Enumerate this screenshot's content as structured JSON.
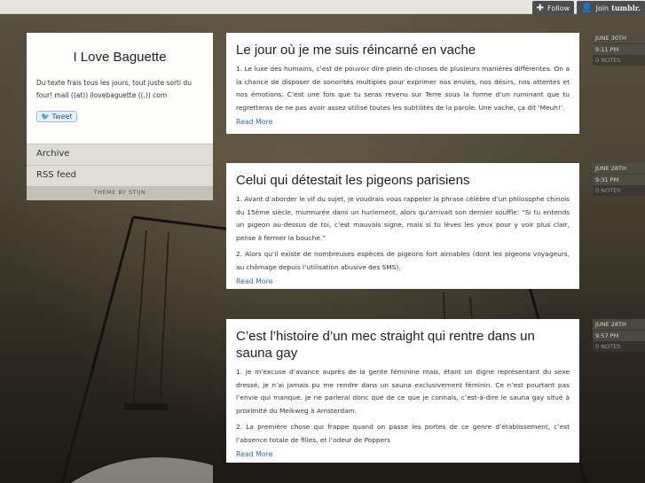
{
  "tumblr": {
    "follow_label": "Follow",
    "join_label": "Join",
    "brand": "tumblr."
  },
  "sidebar": {
    "blog_title": "I Love Baguette",
    "description": "Du texte frais tous les jours, tout juste sorti du four! mail ((at)) ilovebaguette ((.)) com",
    "tweet_label": "Tweet",
    "nav": [
      {
        "label": "Archive"
      },
      {
        "label": "RSS feed"
      }
    ],
    "theme_credit": "THEME BY STIJN"
  },
  "posts": [
    {
      "title": "Le jour où je me suis réincarné en vache",
      "paragraphs": [
        "1. Le luxe des humains, c’est de pouvoir dire plein de choses de plusieurs manières différentes. On a la chance de disposer de sonorités multiples pour exprimer nos envies, nos désirs, nos attentes et nos émotions. C’est une fois que tu seras revenu sur Terre sous la forme d’un ruminant que tu regretteras de ne pas avoir assez utilisé toutes les subtilités de la parole. Une vache, ça dit ‘Meuh!’."
      ],
      "read_more": "Read More",
      "meta": {
        "date": "JUNE 30TH",
        "time": "9:11 PM",
        "notes": "0 NOTES"
      }
    },
    {
      "title": "Celui qui détestait les pigeons parisiens",
      "paragraphs": [
        "1. Avant d’aborder le vif du sujet, je voudrais vous rappeler la phrase célèbre d’un philosophe chinois du 15ème siècle, murmurée dans un hurlement, alors qu’arrivait son dernier souffle: “Si tu entends un pigeon au-dessus de toi, c’est mauvais signe, mais si tu lèves les yeux pour y voir plus clair, pense à fermer la bouche.”",
        "2. Alors qu’il existe de nombreuses espèces de pigeons fort aimables (dont les pigeons voyageurs, au chômage depuis l’utilisation abusive des SMS),"
      ],
      "read_more": "Read More",
      "meta": {
        "date": "JUNE 28TH",
        "time": "9:31 PM",
        "notes": "0 NOTES"
      }
    },
    {
      "title": "C’est l’histoire d’un mec straight qui rentre dans un sauna gay",
      "paragraphs": [
        "1. Je m’excuse d’avance auprès de la gente féminine mais, étant un digne représentant du sexe dressé, je n’ai jamais pu me rendre dans un sauna exclusivement féminin. Ce n’est pourtant pas l’envie qui manque. Je ne parlerai donc que de ce que je connais, c’est-à-dire le sauna gay situé à proximité du Melkweg à Amsterdam.",
        "2. La première chose qui frappe quand on passe les portes de ce genre d’établissement, c’est l’absence totale de filles, et l’odeur de Poppers"
      ],
      "read_more": "Read More",
      "meta": {
        "date": "JUNE 28TH",
        "time": "9:57 PM",
        "notes": "0 NOTES"
      }
    }
  ]
}
